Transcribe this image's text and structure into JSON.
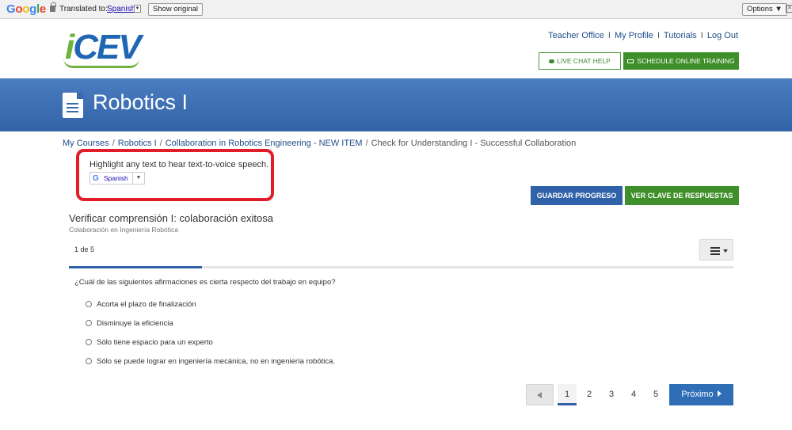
{
  "translate_bar": {
    "brand": "Google",
    "translated_to_label": "Translated to:",
    "language": "Spanish",
    "dropdown_arrow": "▼",
    "show_original_label": "Show original",
    "options_label": "Options ▼"
  },
  "header": {
    "logo_i": "i",
    "logo_text": "CEV",
    "links": {
      "teacher_office": "Teacher Office",
      "my_profile": "My Profile",
      "tutorials": "Tutorials",
      "log_out": "Log Out",
      "separator": "I"
    },
    "live_chat_label": "LIVE CHAT HELP",
    "schedule_label": "SCHEDULE ONLINE TRAINING"
  },
  "banner": {
    "title": "Robotics I",
    "icon": "document-icon"
  },
  "breadcrumb": {
    "items": [
      "My Courses",
      "Robotics I",
      "Collaboration in Robotics Engineering - NEW ITEM",
      "Check for Understanding I - Successful Collaboration"
    ],
    "separator": "/"
  },
  "tts": {
    "instruction": "Highlight any text to hear text-to-voice speech.",
    "language": "Spanish",
    "arrow": "▼",
    "g_glyph": "G"
  },
  "actions": {
    "save_label": "GUARDAR PROGRESO",
    "key_label": "VER CLAVE DE RESPUESTAS"
  },
  "quiz": {
    "title": "Verificar comprensión I: colaboración exitosa",
    "subtitle": "Colaboración en Ingeniería Robótica",
    "progress_text": "1 de 5",
    "progress_fraction": 0.2,
    "question": "¿Cuál de las siguientes afirmaciones es cierta respecto del trabajo en equipo?",
    "options": [
      "Acorta el plazo de finalización",
      "Disminuye la eficiencia",
      "Sólo tiene espacio para un experto",
      "Sólo se puede lograr en ingeniería mecánica, no en ingeniería robótica."
    ]
  },
  "pagination": {
    "pages": [
      "1",
      "2",
      "3",
      "4",
      "5"
    ],
    "current": "1",
    "next_label": "Próximo"
  },
  "colors": {
    "brand_blue": "#2f62a8",
    "brand_green": "#3f8f2a",
    "highlight_red": "#e11d2a"
  }
}
